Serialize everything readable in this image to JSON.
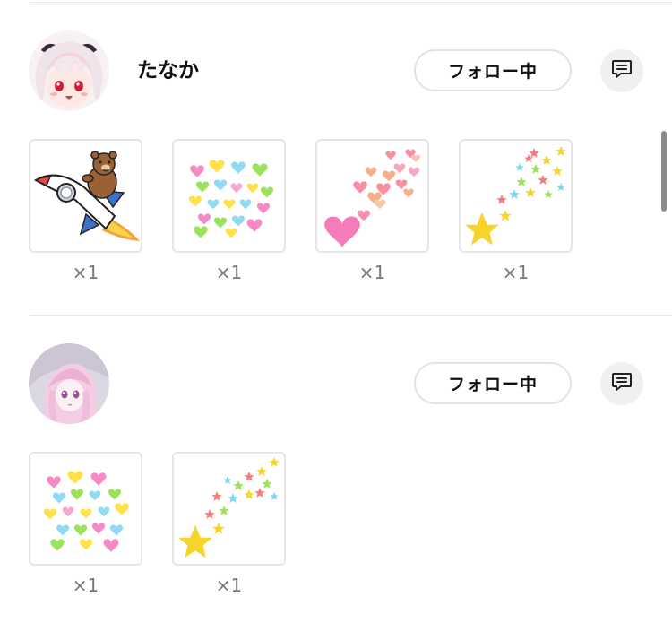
{
  "colors": {
    "divider": "#e6e6e6",
    "button_border": "#e3e3e3",
    "message_button_bg": "#f0f0f0",
    "count_text": "#777777"
  },
  "users": [
    {
      "name": "たなか",
      "follow_label": "フォロー中",
      "avatar": "anime-girl-red-eyes",
      "message_icon": "chat-icon",
      "gifts": [
        {
          "icon": "bear-rocket-icon",
          "count": "×1"
        },
        {
          "icon": "pastel-hearts-icon",
          "count": "×1"
        },
        {
          "icon": "heart-trail-icon",
          "count": "×1"
        },
        {
          "icon": "star-trail-icon",
          "count": "×1"
        }
      ]
    },
    {
      "name": "",
      "follow_label": "フォロー中",
      "avatar": "anime-girl-pink-hair",
      "message_icon": "chat-icon",
      "gifts": [
        {
          "icon": "pastel-hearts-icon",
          "count": "×1"
        },
        {
          "icon": "star-trail-icon",
          "count": "×1"
        }
      ]
    }
  ]
}
